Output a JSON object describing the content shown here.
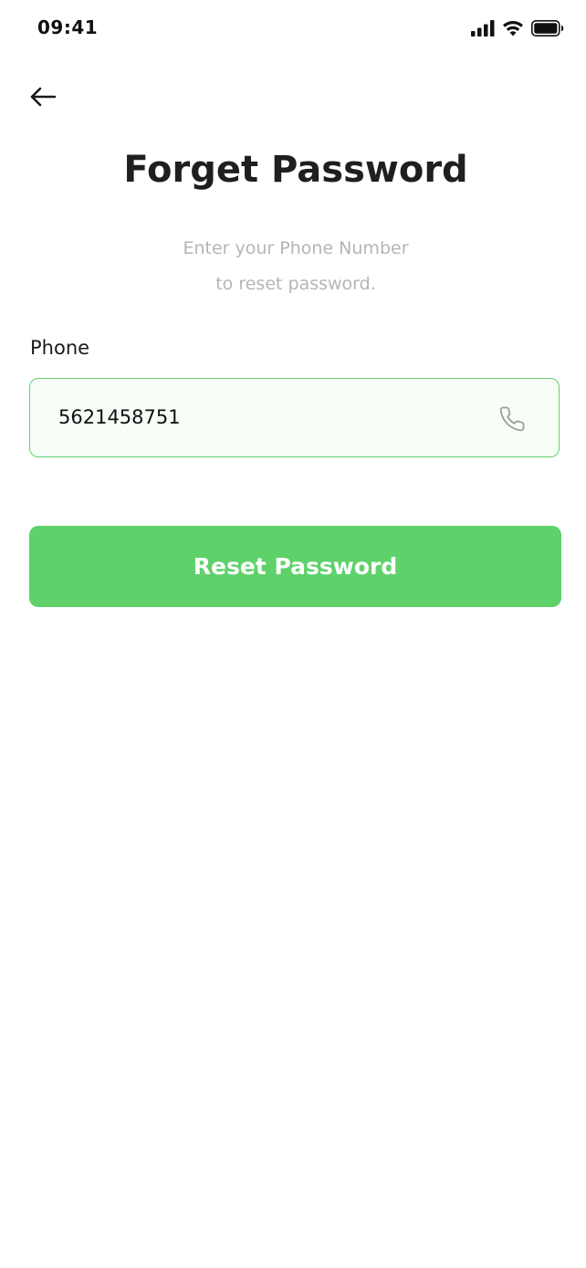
{
  "status_bar": {
    "time": "09:41",
    "icons": [
      "signal-icon",
      "wifi-icon",
      "battery-icon"
    ]
  },
  "header": {
    "back_icon": "arrow-left-icon",
    "title": "Forget Password",
    "subtitle_line1": "Enter your Phone Number",
    "subtitle_line2": "to reset password."
  },
  "form": {
    "phone_label": "Phone",
    "phone_value": "5621458751",
    "phone_icon": "phone-icon",
    "submit_label": "Reset Password"
  },
  "colors": {
    "accent": "#5fd16b",
    "field_background": "#f7fdf7",
    "subtitle": "#b5b5b5",
    "text": "#1f1f1f"
  }
}
